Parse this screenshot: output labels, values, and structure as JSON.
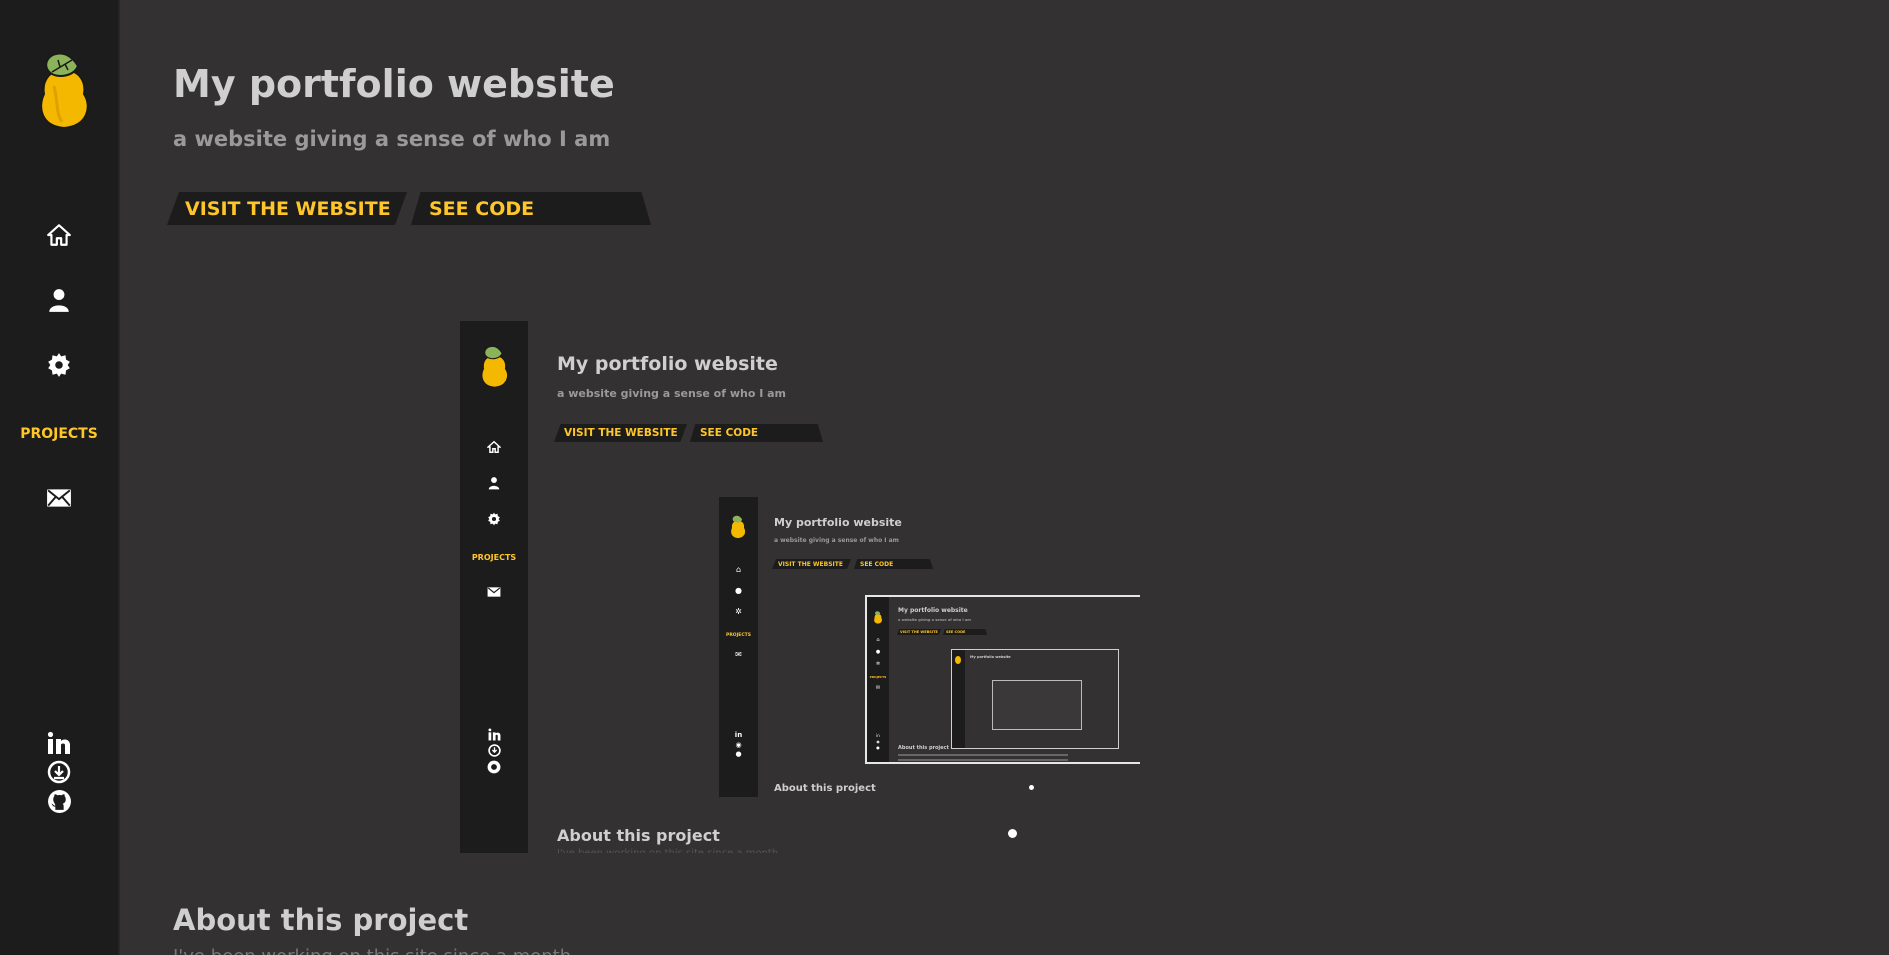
{
  "sidebar": {
    "logo_icon": "pear-logo-icon",
    "nav": [
      {
        "icon": "home-icon"
      },
      {
        "icon": "user-icon"
      },
      {
        "icon": "gear-icon"
      },
      {
        "label": "PROJECTS"
      },
      {
        "icon": "mail-icon"
      }
    ],
    "social": [
      {
        "icon": "linkedin-icon"
      },
      {
        "icon": "download-icon"
      },
      {
        "icon": "github-icon"
      }
    ]
  },
  "project": {
    "title": "My portfolio website",
    "subtitle": "a website giving a sense of who I am",
    "visit_label": "VISIT THE WEBSITE",
    "code_label": "SEE CODE",
    "about_heading": "About this project",
    "about_text_partial": "I've been working on this site since a month..."
  },
  "colors": {
    "accent": "#ffc629",
    "background": "#333132",
    "sidebar": "#1c1c1c",
    "title": "#cfcfcf",
    "subtitle": "#9a9a9a"
  }
}
